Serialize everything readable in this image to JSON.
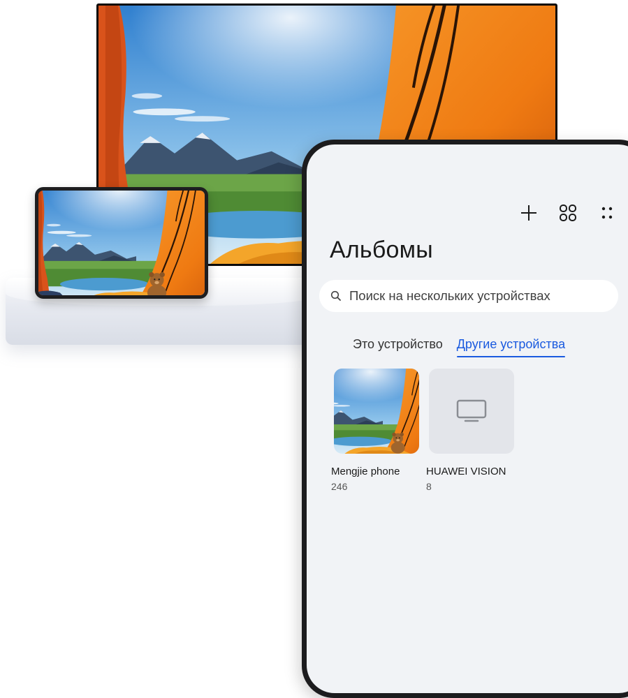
{
  "phone": {
    "toolbar": {
      "add_icon": "plus-icon",
      "grid_icon": "grid-icon",
      "more_icon": "more-icon"
    },
    "title": "Альбомы",
    "search": {
      "icon": "search-icon",
      "placeholder": "Поиск на нескольких устройствах"
    },
    "tabs": [
      {
        "label": "Это устройство",
        "active": false
      },
      {
        "label": "Другие устройства",
        "active": true
      }
    ],
    "albums": [
      {
        "name": "Mengjie phone",
        "count": "246",
        "thumb": "tent-photo"
      },
      {
        "name": "HUAWEI VISION",
        "count": "8",
        "thumb": "tv-icon"
      }
    ]
  },
  "colors": {
    "accent": "#1a5adf",
    "screen_bg": "#f1f3f6",
    "tent_orange": "#f0801e",
    "sky_blue": "#3f8fd6"
  }
}
